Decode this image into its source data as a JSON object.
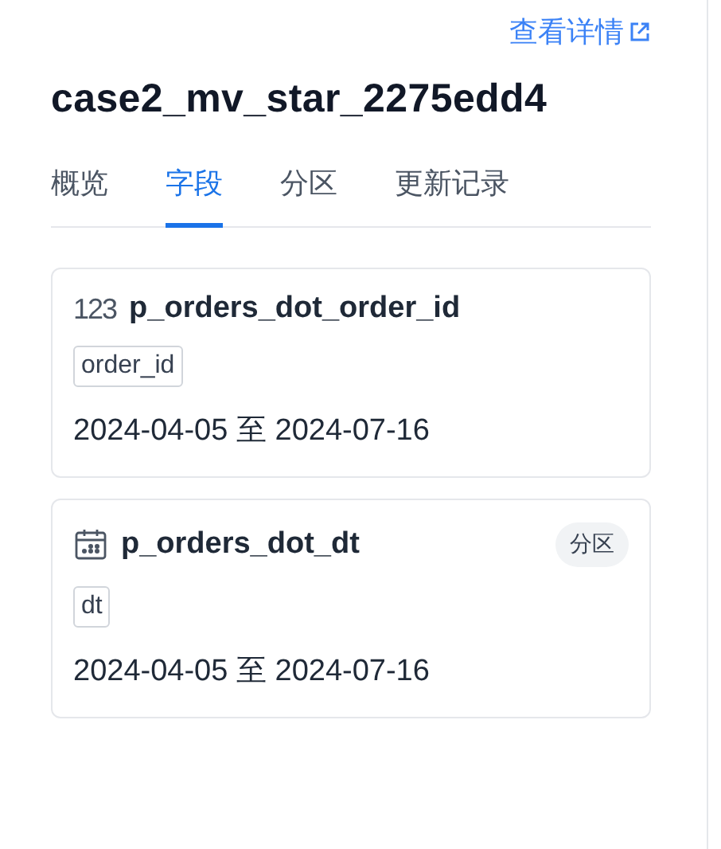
{
  "detail_link": "查看详情",
  "title": "case2_mv_star_2275edd4",
  "tabs": [
    {
      "label": "概览",
      "selected": false
    },
    {
      "label": "字段",
      "selected": true
    },
    {
      "label": "分区",
      "selected": false
    },
    {
      "label": "更新记录",
      "selected": false
    }
  ],
  "fields": [
    {
      "kind": "number",
      "type_label": "123",
      "name": "p_orders_dot_order_id",
      "column": "order_id",
      "range": "2024-04-05 至 2024-07-16"
    },
    {
      "kind": "date",
      "name": "p_orders_dot_dt",
      "badge": "分区",
      "column": "dt",
      "range": "2024-04-05 至 2024-07-16"
    }
  ]
}
